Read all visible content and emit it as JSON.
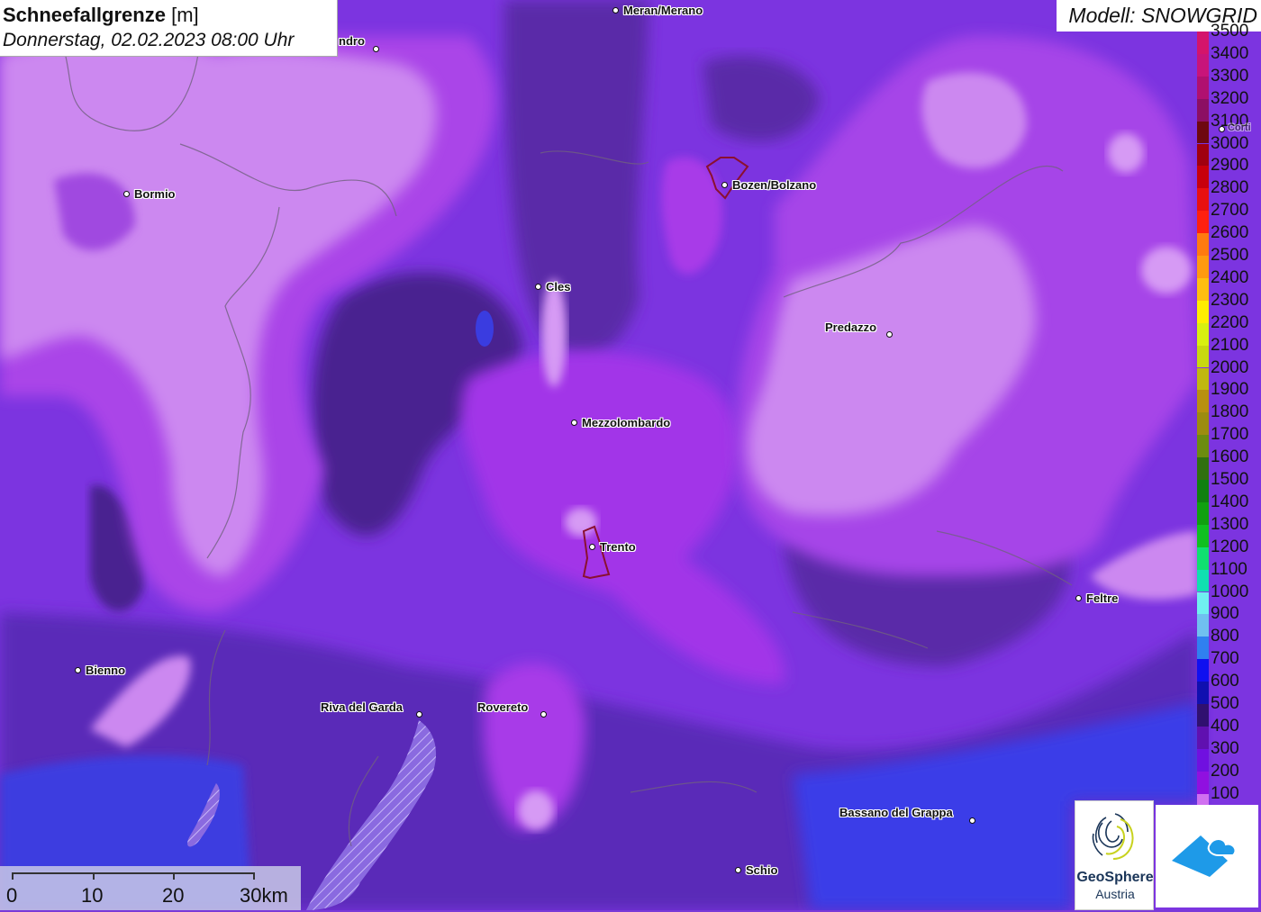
{
  "header": {
    "title": "Schneefallgrenze",
    "unit": "[m]",
    "datetime": "Donnerstag, 02.02.2023 08:00 Uhr"
  },
  "model": "Modell: SNOWGRID",
  "legend": {
    "items": [
      {
        "label": "3500",
        "color": "#d4146b"
      },
      {
        "label": "3400",
        "color": "#c8147a"
      },
      {
        "label": "3300",
        "color": "#b01070"
      },
      {
        "label": "3200",
        "color": "#8c0f64"
      },
      {
        "label": "3100",
        "color": "#6e0810"
      },
      {
        "label": "3000",
        "color": "#a00010"
      },
      {
        "label": "2900",
        "color": "#c8000c"
      },
      {
        "label": "2800",
        "color": "#e81010"
      },
      {
        "label": "2700",
        "color": "#ff2010"
      },
      {
        "label": "2600",
        "color": "#ff7a10"
      },
      {
        "label": "2500",
        "color": "#ff9a10"
      },
      {
        "label": "2400",
        "color": "#ffbe10"
      },
      {
        "label": "2300",
        "color": "#ffee00"
      },
      {
        "label": "2200",
        "color": "#d8f010"
      },
      {
        "label": "2100",
        "color": "#c8d810"
      },
      {
        "label": "2000",
        "color": "#c0b810"
      },
      {
        "label": "1900",
        "color": "#b89010"
      },
      {
        "label": "1800",
        "color": "#9c8c10"
      },
      {
        "label": "1700",
        "color": "#6c8c10"
      },
      {
        "label": "1600",
        "color": "#307010"
      },
      {
        "label": "1500",
        "color": "#108010"
      },
      {
        "label": "1400",
        "color": "#10a010"
      },
      {
        "label": "1300",
        "color": "#10c020"
      },
      {
        "label": "1200",
        "color": "#10e070"
      },
      {
        "label": "1100",
        "color": "#10e0b0"
      },
      {
        "label": "1000",
        "color": "#70f0f0"
      },
      {
        "label": "900",
        "color": "#70c0f0"
      },
      {
        "label": "800",
        "color": "#3080f0"
      },
      {
        "label": "700",
        "color": "#1010f0"
      },
      {
        "label": "600",
        "color": "#1010b0"
      },
      {
        "label": "500",
        "color": "#301070"
      },
      {
        "label": "400",
        "color": "#6010b0"
      },
      {
        "label": "300",
        "color": "#7010e0"
      },
      {
        "label": "200",
        "color": "#9010e0"
      },
      {
        "label": "100",
        "color": "#d070f0"
      }
    ]
  },
  "cities": [
    {
      "name": "Meran/Merano"
    },
    {
      "name": "ndro"
    },
    {
      "name": "Bormio"
    },
    {
      "name": "Bozen/Bolzano"
    },
    {
      "name": "Cles"
    },
    {
      "name": "Predazzo"
    },
    {
      "name": "Mezzolombardo"
    },
    {
      "name": "Trento"
    },
    {
      "name": "Feltre"
    },
    {
      "name": "Bienno"
    },
    {
      "name": "Riva del Garda"
    },
    {
      "name": "Rovereto"
    },
    {
      "name": "Bassano del Grappa"
    },
    {
      "name": "Schio"
    },
    {
      "name": "Corti"
    }
  ],
  "scale": {
    "labels": [
      "0",
      "10",
      "20",
      "30km"
    ]
  },
  "logos": {
    "geosphere_line1": "GeoSphere",
    "geosphere_line2": "Austria"
  }
}
